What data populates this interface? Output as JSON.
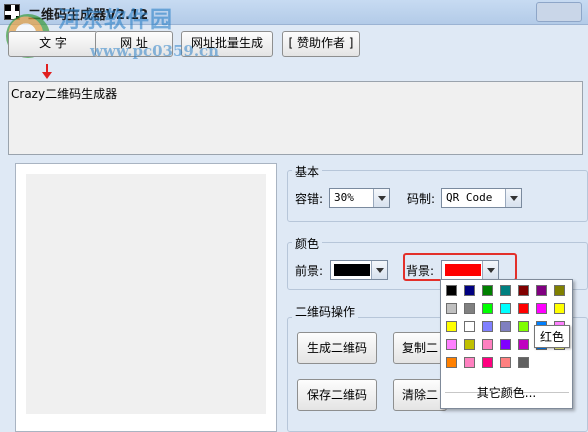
{
  "window": {
    "title": "二维码生成器V2.12"
  },
  "watermark": {
    "text": "河东软件园",
    "url": "www.pc0359.cn"
  },
  "toolbar": {
    "text_tab": "文  字",
    "url_tab": "网  址",
    "batch_tab": "网址批量生成",
    "sponsor": "[ 赞助作者 ]"
  },
  "input": {
    "value": "Crazy二维码生成器"
  },
  "basic": {
    "title": "基本",
    "tolerance_label": "容错:",
    "tolerance_value": "30%",
    "code_label": "码制:",
    "code_value": "QR Code"
  },
  "color": {
    "title": "颜色",
    "fg_label": "前景:",
    "fg_color": "#000000",
    "bg_label": "背景:",
    "bg_color": "#ff0000"
  },
  "actions": {
    "title": "二维码操作",
    "generate": "生成二维码",
    "copy": "复制二",
    "save": "保存二维码",
    "clear": "清除二"
  },
  "palette": {
    "rows": [
      [
        "#000000",
        "#000080",
        "#008000",
        "#008080",
        "#800000",
        "#800080",
        "#808000"
      ],
      [
        "#c0c0c0",
        "#808080",
        "#00ff00",
        "#00ffff",
        "#ff0000",
        "#ff00ff",
        "#ffff00"
      ],
      [
        "#ffff00",
        "#ffffff",
        "#8080ff",
        "#8080c0",
        "#80ff00",
        "#0080ff",
        "#ff80ff"
      ],
      [
        "#ff80ff",
        "#c0c000",
        "#ff80c0",
        "#8000ff",
        "#c000c0",
        "#0080ff",
        "#ffff80"
      ],
      [
        "#ff8000",
        "#ff80c0",
        "#ff0080",
        "#ff8080",
        "#606060"
      ]
    ],
    "more": "其它颜色...",
    "tooltip": "红色"
  }
}
